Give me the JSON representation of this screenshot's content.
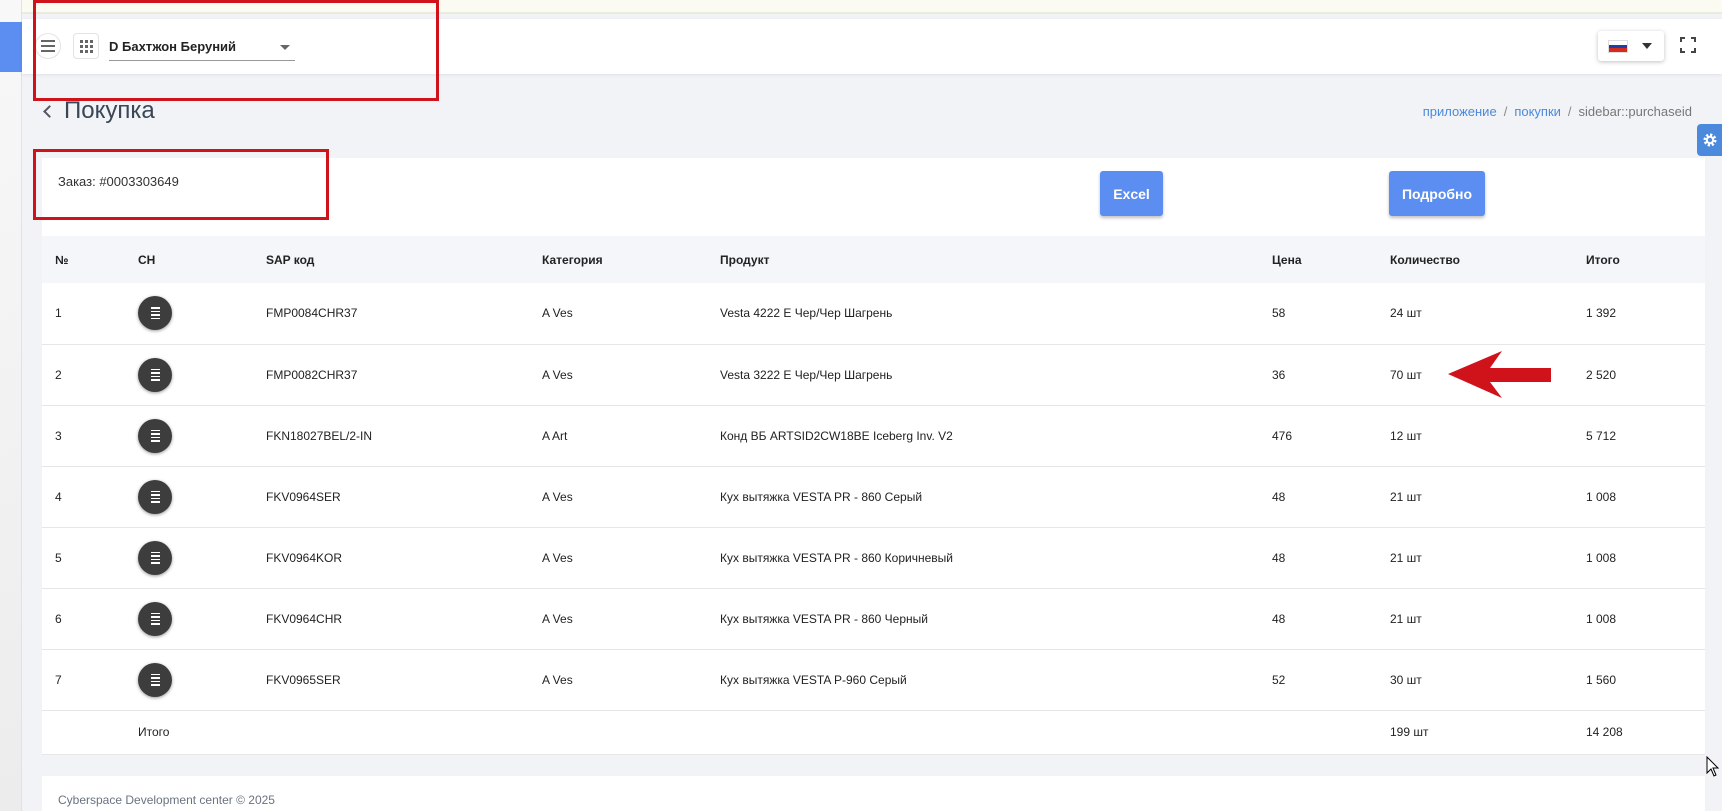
{
  "header": {
    "branch": "D Бахтжон Беруний"
  },
  "page": {
    "title": "Покупка"
  },
  "breadcrumb": [
    "приложение",
    "покупки",
    "sidebar::purchaseid"
  ],
  "order": {
    "label": "Заказ: #0003303649"
  },
  "buttons": {
    "excel": "Excel",
    "detail": "Подробно"
  },
  "table": {
    "columns": [
      "№",
      "CH",
      "SAP код",
      "Категория",
      "Продукт",
      "Цена",
      "Количество",
      "Итого"
    ],
    "rows": [
      {
        "n": "1",
        "sap": "FMP0084CHR37",
        "cat": "A Ves",
        "product": "Vesta 4222 E Чер/Чер Шагрень",
        "price": "58",
        "qty": "24 шт",
        "total": "1 392"
      },
      {
        "n": "2",
        "sap": "FMP0082CHR37",
        "cat": "A Ves",
        "product": "Vesta 3222 E Чер/Чер Шагрень",
        "price": "36",
        "qty": "70 шт",
        "total": "2 520"
      },
      {
        "n": "3",
        "sap": "FKN18027BEL/2-IN",
        "cat": "A Art",
        "product": "Конд ВБ ARTSID2CW18BE Iceberg Inv. V2",
        "price": "476",
        "qty": "12 шт",
        "total": "5 712"
      },
      {
        "n": "4",
        "sap": "FKV0964SER",
        "cat": "A Ves",
        "product": "Кух вытяжка VESTA PR - 860 Серый",
        "price": "48",
        "qty": "21 шт",
        "total": "1 008"
      },
      {
        "n": "5",
        "sap": "FKV0964KOR",
        "cat": "A Ves",
        "product": "Кух вытяжка VESTA PR - 860 Коричневый",
        "price": "48",
        "qty": "21 шт",
        "total": "1 008"
      },
      {
        "n": "6",
        "sap": "FKV0964CHR",
        "cat": "A Ves",
        "product": "Кух вытяжка VESTA PR - 860 Черный",
        "price": "48",
        "qty": "21 шт",
        "total": "1 008"
      },
      {
        "n": "7",
        "sap": "FKV0965SER",
        "cat": "A Ves",
        "product": "Кух вытяжка VESTA P-960 Серый",
        "price": "52",
        "qty": "30 шт",
        "total": "1 560"
      }
    ],
    "footer": {
      "label": "Итого",
      "qty": "199 шт",
      "total": "14 208"
    }
  },
  "footer": {
    "copyright": "Cyberspace Development center © 2025"
  },
  "colors": {
    "accent": "#5b8ef0",
    "annotation": "#d0121b"
  },
  "icons": [
    "menu-icon",
    "apps-grid-icon",
    "chevron-down-icon",
    "russia-flag-icon",
    "fullscreen-icon",
    "back-chevron-icon",
    "gear-icon",
    "list-icon"
  ]
}
